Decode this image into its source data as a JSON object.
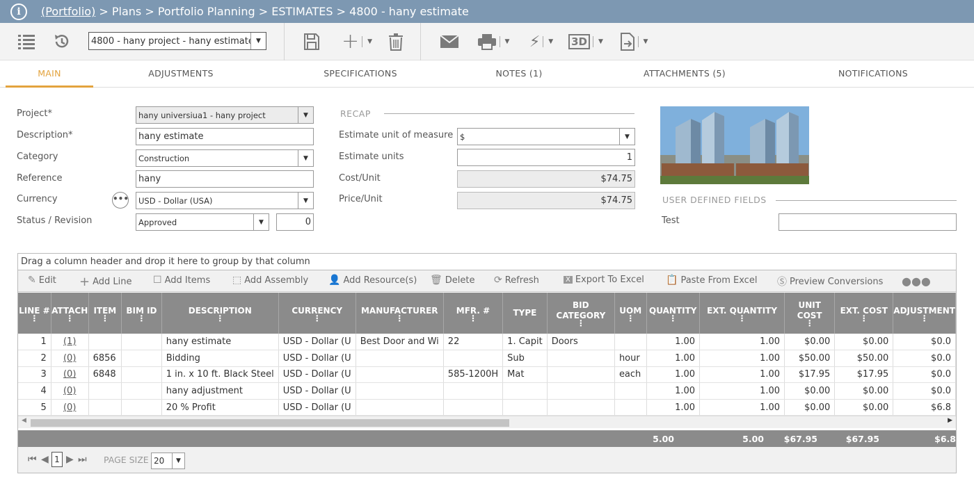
{
  "breadcrumb": {
    "portfolio": "(Portfolio)",
    "rest": " > Plans > Portfolio Planning > ESTIMATES > 4800 - hany estimate"
  },
  "toolbar": {
    "project_select": "4800 - hany project - hany estimate"
  },
  "tabs": [
    "MAIN",
    "ADJUSTMENTS",
    "SPECIFICATIONS",
    "NOTES (1)",
    "ATTACHMENTS (5)",
    "NOTIFICATIONS"
  ],
  "form": {
    "project_label": "Project*",
    "project_value": "hany universiua1 - hany project",
    "description_label": "Description*",
    "description_value": "hany estimate",
    "category_label": "Category",
    "category_value": "Construction",
    "reference_label": "Reference",
    "reference_value": "hany",
    "currency_label": "Currency",
    "currency_value": "USD - Dollar (USA)",
    "status_label": "Status / Revision",
    "status_value": "Approved",
    "revision_value": "0"
  },
  "recap": {
    "header": "RECAP",
    "unit_measure_label": "Estimate unit of measure",
    "unit_measure_value": "$",
    "units_label": "Estimate units",
    "units_value": "1",
    "cost_unit_label": "Cost/Unit",
    "cost_unit_value": "$74.75",
    "price_unit_label": "Price/Unit",
    "price_unit_value": "$74.75"
  },
  "udf": {
    "header": "USER DEFINED FIELDS",
    "test_label": "Test",
    "test_value": ""
  },
  "grid": {
    "group_hint": "Drag a column header and drop it here to group by that column",
    "toolbar": [
      "Edit",
      "Add Line",
      "Add Items",
      "Add Assembly",
      "Add Resource(s)",
      "Delete",
      "Refresh",
      "Export To Excel",
      "Paste From Excel",
      "Preview Conversions"
    ],
    "columns": [
      "LINE #",
      "ATTACH",
      "ITEM",
      "BIM ID",
      "DESCRIPTION",
      "CURRENCY",
      "MANUFACTURER",
      "MFR. #",
      "TYPE",
      "BID CATEGORY",
      "UOM",
      "QUANTITY",
      "EXT. QUANTITY",
      "UNIT COST",
      "EXT. COST",
      "ADJUSTMENT"
    ],
    "rows": [
      [
        "1",
        "(1)",
        "",
        "",
        "hany estimate",
        "USD - Dollar (U",
        "Best Door and Wi",
        "22",
        "1. Capit",
        "Doors",
        "",
        "1.00",
        "1.00",
        "$0.00",
        "$0.00",
        "$0.0"
      ],
      [
        "2",
        "(0)",
        "6856",
        "",
        "Bidding",
        "USD - Dollar (U",
        "",
        "",
        "Sub",
        "",
        "hour",
        "1.00",
        "1.00",
        "$50.00",
        "$50.00",
        "$0.0"
      ],
      [
        "3",
        "(0)",
        "6848",
        "",
        "1 in. x 10 ft. Black Steel",
        "USD - Dollar (U",
        "",
        "585-1200H",
        "Mat",
        "",
        "each",
        "1.00",
        "1.00",
        "$17.95",
        "$17.95",
        "$0.0"
      ],
      [
        "4",
        "(0)",
        "",
        "",
        "hany adjustment",
        "USD - Dollar (U",
        "",
        "",
        "",
        "",
        "",
        "1.00",
        "1.00",
        "$0.00",
        "$0.00",
        "$0.0"
      ],
      [
        "5",
        "(0)",
        "",
        "",
        "20 % Profit",
        "USD - Dollar (U",
        "",
        "",
        "",
        "",
        "",
        "1.00",
        "1.00",
        "$0.00",
        "$0.00",
        "$6.8"
      ]
    ],
    "totals": {
      "quantity": "5.00",
      "ext_quantity": "5.00",
      "unit_cost": "$67.95",
      "ext_cost": "$67.95",
      "adjustment": "$6.8"
    },
    "pager": {
      "page": "1",
      "page_size_label": "PAGE SIZE",
      "page_size": "20"
    }
  }
}
